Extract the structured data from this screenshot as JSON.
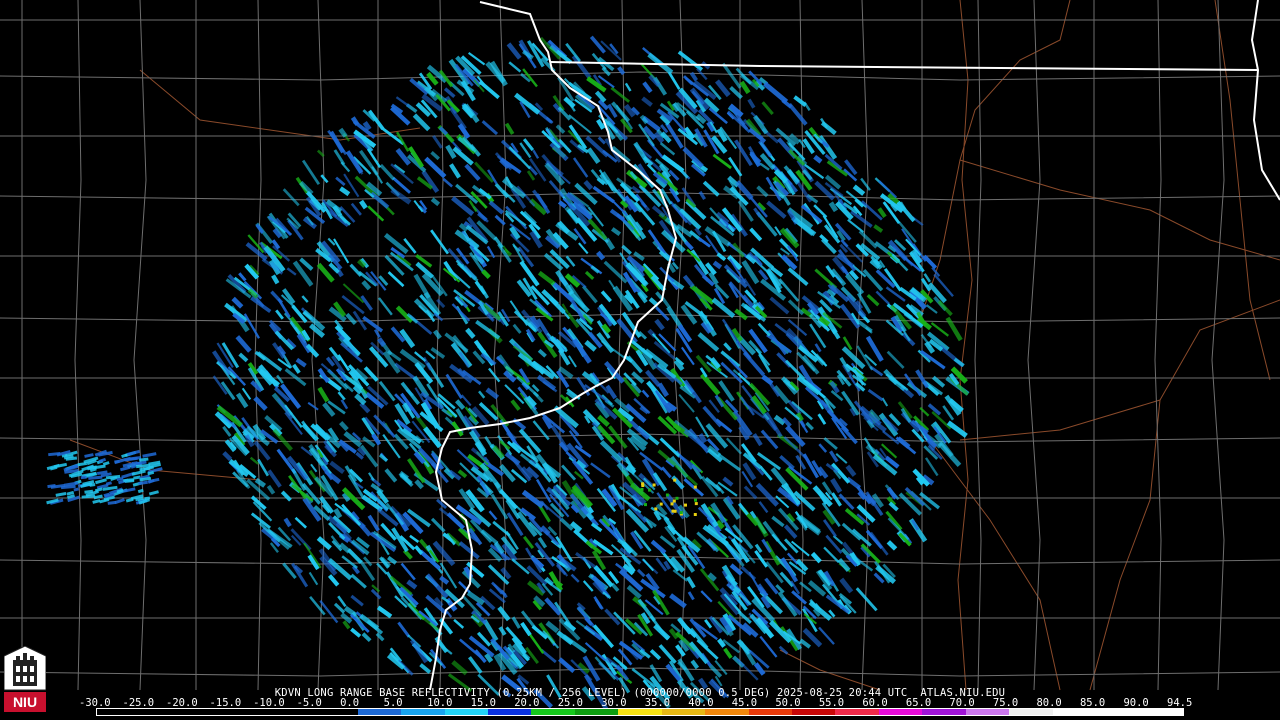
{
  "product_title": "KDVN LONG RANGE BASE REFLECTIVITY (0.25KM / 256 LEVEL) (000000/0000 0.5 DEG) 2025-08-25 20:44 UTC  ATLAS.NIU.EDU",
  "logo_text": "NIU",
  "colorbar": {
    "labels": [
      "-30.0",
      "-25.0",
      "-20.0",
      "-15.0",
      "-10.0",
      "-5.0",
      "0.0",
      "5.0",
      "10.0",
      "15.0",
      "20.0",
      "25.0",
      "30.0",
      "35.0",
      "40.0",
      "45.0",
      "50.0",
      "55.0",
      "60.0",
      "65.0",
      "70.0",
      "75.0",
      "80.0",
      "85.0",
      "90.0",
      "94.5"
    ],
    "colors": [
      "#000000",
      "#000000",
      "#000000",
      "#000000",
      "#000000",
      "#000000",
      "#1e6ad6",
      "#18a4f0",
      "#22d4f8",
      "#0a32e0",
      "#16c81c",
      "#0e9e10",
      "#f6e214",
      "#e6b814",
      "#f2880c",
      "#e83a0a",
      "#c80808",
      "#f02a4a",
      "#e60ad8",
      "#a014d8",
      "#cc78ee",
      "#f0f0f0",
      "#ffffff",
      "#ffffff",
      "#ffffff"
    ]
  },
  "colors": {
    "background": "#000000",
    "county_lines": "#6e6e6e",
    "state_lines": "#ffffff",
    "highways": "#8a4a2a",
    "echo_light": "#22c8f0",
    "echo_medium": "#1e6ad6",
    "echo_green": "#18b018",
    "echo_yellow": "#e8d010"
  }
}
